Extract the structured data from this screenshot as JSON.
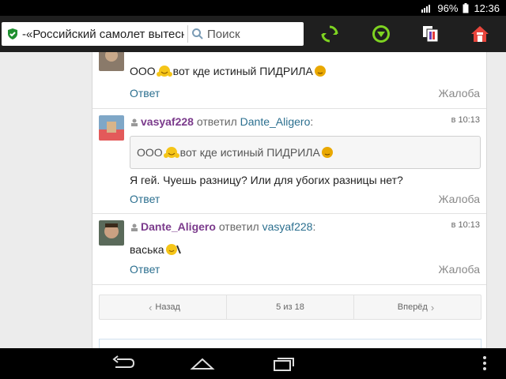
{
  "status": {
    "battery": "96%",
    "time": "12:36"
  },
  "browser": {
    "url": "-«Российский самолет вытесни",
    "search_placeholder": "Поиск"
  },
  "posts": [
    {
      "message": "ООО",
      "message_tail": " вот кде истиный ПИДРИЛА",
      "reply_label": "Ответ",
      "complain_label": "Жалоба"
    },
    {
      "user": "vasyaf228",
      "verb": "ответил",
      "reply_to": "Dante_Aligero",
      "colon": ":",
      "time": "в 10:13",
      "quote": "ООО",
      "quote_tail": " вот кде истиный ПИДРИЛА",
      "message": "Я гей. Чуешь разницу? Или для убогих разницы нет?",
      "reply_label": "Ответ",
      "complain_label": "Жалоба"
    },
    {
      "user": "Dante_Aligero",
      "verb": "ответил",
      "reply_to": "vasyaf228",
      "colon": ":",
      "time": "в 10:13",
      "message": "васька",
      "reply_label": "Ответ",
      "complain_label": "Жалоба"
    }
  ],
  "pager": {
    "prev": "Назад",
    "page": "5 из 18",
    "next": "Вперёд"
  },
  "colors": {
    "accent_purple": "#7b3b8c",
    "link_blue": "#2b6f8f",
    "toolbar": "#1f1f1f"
  }
}
